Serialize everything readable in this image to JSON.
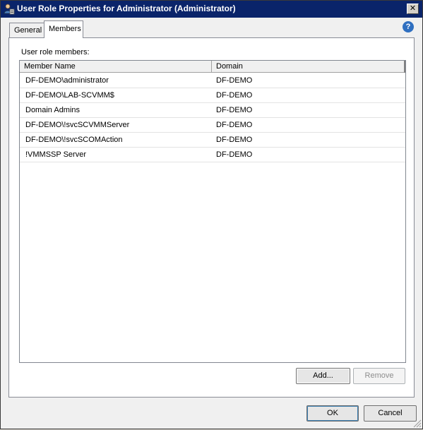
{
  "window": {
    "title": "User Role Properties for Administrator (Administrator)",
    "close_glyph": "✕"
  },
  "tabs": [
    {
      "label": "General",
      "active": false
    },
    {
      "label": "Members",
      "active": true
    }
  ],
  "help_glyph": "?",
  "members": {
    "section_label": "User role members:",
    "columns": [
      "Member Name",
      "Domain"
    ],
    "rows": [
      {
        "name": "DF-DEMO\\administrator",
        "domain": "DF-DEMO"
      },
      {
        "name": "DF-DEMO\\LAB-SCVMM$",
        "domain": "DF-DEMO"
      },
      {
        "name": "Domain Admins",
        "domain": "DF-DEMO"
      },
      {
        "name": "DF-DEMO\\!svcSCVMMServer",
        "domain": "DF-DEMO"
      },
      {
        "name": "DF-DEMO\\!svcSCOMAction",
        "domain": "DF-DEMO"
      },
      {
        "name": "!VMMSSP Server",
        "domain": "DF-DEMO"
      }
    ],
    "add_label": "Add...",
    "remove_label": "Remove"
  },
  "footer": {
    "ok_label": "OK",
    "cancel_label": "Cancel"
  },
  "colors": {
    "titlebar": "#0a246a",
    "help": "#2f6fc0"
  }
}
